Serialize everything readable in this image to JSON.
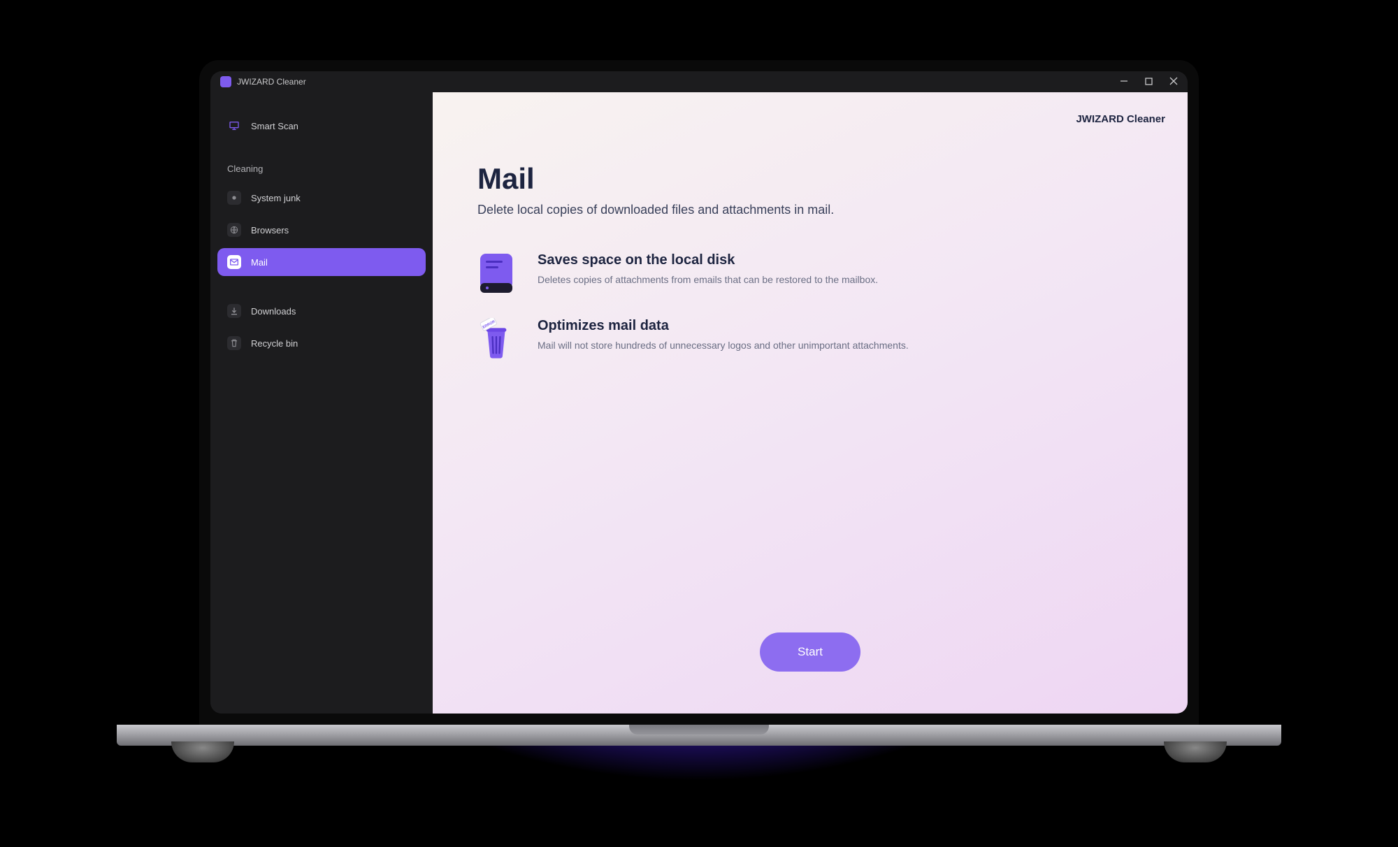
{
  "titlebar": {
    "app_name": "JWIZARD Cleaner"
  },
  "sidebar": {
    "smart_scan": "Smart Scan",
    "section_cleaning": "Cleaning",
    "items": [
      {
        "label": "System junk"
      },
      {
        "label": "Browsers"
      },
      {
        "label": "Mail"
      },
      {
        "label": "Downloads"
      },
      {
        "label": "Recycle bin"
      }
    ]
  },
  "content": {
    "brand": "JWIZARD Cleaner",
    "title": "Mail",
    "subtitle": "Delete local copies of downloaded files and attachments in mail.",
    "features": [
      {
        "title": "Saves space on the local disk",
        "desc": "Deletes copies of attachments from emails that can be restored to the mailbox."
      },
      {
        "title": "Optimizes mail data",
        "desc": "Mail will not store hundreds of unnecessary logos and other unimportant attachments."
      }
    ],
    "start_button": "Start"
  }
}
